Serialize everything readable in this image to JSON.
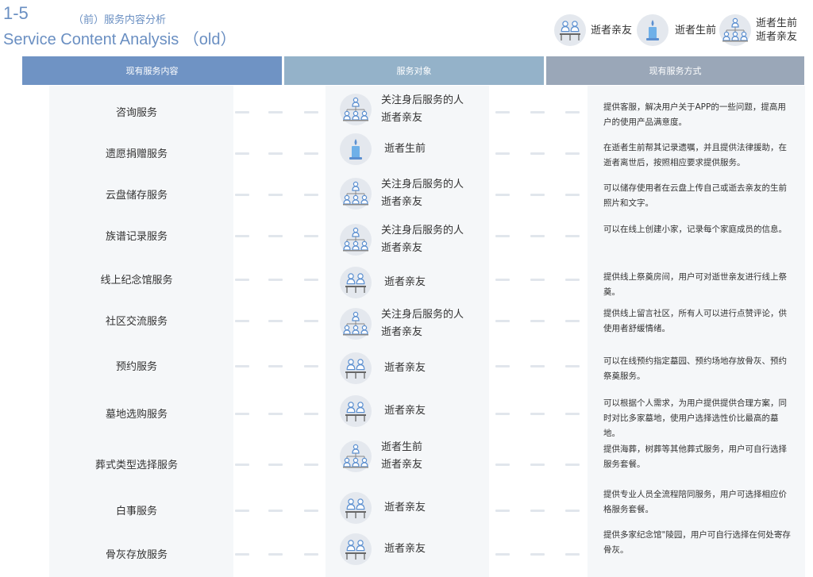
{
  "header": {
    "number": "1-5",
    "subtitle": "（前）服务内容分析",
    "title_en": "Service Content Analysis （old）"
  },
  "legend": [
    {
      "icon": "family-group-icon",
      "label": "逝者亲友"
    },
    {
      "icon": "candle-icon",
      "label": "逝者生前"
    },
    {
      "icon": "org-tree-icon",
      "label_line1": "逝者生前",
      "label_line2": "逝者亲友"
    }
  ],
  "columns": {
    "content": "现有服务内容",
    "audience": "服务对象",
    "mode": "现有服务方式"
  },
  "colors": {
    "col1": "#6f93c4",
    "col2": "#94b2c9",
    "col3": "#9aa7b8",
    "panel": "#f5f7f9",
    "icon_blue": "#5b8fd0"
  },
  "rows": [
    {
      "service": "咨询服务",
      "icon": "org-tree-icon",
      "audience": [
        "关注身后服务的人",
        "逝者亲友"
      ],
      "mode": "提供客服，解决用户关于APP的一些问题，提高用户的使用产品满意度。"
    },
    {
      "service": "遗愿捐赠服务",
      "icon": "candle-icon",
      "audience": [
        "逝者生前"
      ],
      "mode": "在逝者生前帮其记录遗嘱，并且提供法律援助，在逝者离世后，按照相应要求提供服务。"
    },
    {
      "service": "云盘储存服务",
      "icon": "org-tree-icon",
      "audience": [
        "关注身后服务的人",
        "逝者亲友"
      ],
      "mode": "可以储存使用者在云盘上传自己或逝去亲友的生前照片和文字。"
    },
    {
      "service": "族谱记录服务",
      "icon": "org-tree-icon",
      "audience": [
        "关注身后服务的人",
        "逝者亲友"
      ],
      "mode": "可以在线上创建小家，记录每个家庭成员的信息。"
    },
    {
      "service": "线上纪念馆服务",
      "icon": "family-group-icon",
      "audience": [
        "逝者亲友"
      ],
      "mode": "提供线上祭奠房间，用户可对逝世亲友进行线上祭奠。"
    },
    {
      "service": "社区交流服务",
      "icon": "org-tree-icon",
      "audience": [
        "关注身后服务的人",
        "逝者亲友"
      ],
      "mode": "提供线上留言社区，所有人可以进行点赞评论，供使用者舒缓情绪。"
    },
    {
      "service": "预约服务",
      "icon": "family-group-icon",
      "audience": [
        "逝者亲友"
      ],
      "mode": "可以在线预约指定墓园、预约场地存放骨灰、预约祭奠服务。"
    },
    {
      "service": "墓地选购服务",
      "icon": "family-group-icon",
      "audience": [
        "逝者亲友"
      ],
      "mode": "可以根据个人需求，为用户提供提供合理方案，同时对比多家墓地，使用户选择选性价比最高的墓地。"
    },
    {
      "service": "葬式类型选择服务",
      "icon": "org-tree-icon",
      "audience": [
        "逝者生前",
        "逝者亲友"
      ],
      "mode": "提供海葬，树葬等其他葬式服务，用户可自行选择服务套餐。"
    },
    {
      "service": "白事服务",
      "icon": "family-group-icon",
      "audience": [
        "逝者亲友"
      ],
      "mode": "提供专业人员全流程陪同服务，用户可选择相应价格服务套餐。"
    },
    {
      "service": "骨灰存放服务",
      "icon": "family-group-icon",
      "audience": [
        "逝者亲友"
      ],
      "mode": "提供多家纪念馆\"陵园，用户可自行选择在何处寄存骨灰。"
    }
  ]
}
